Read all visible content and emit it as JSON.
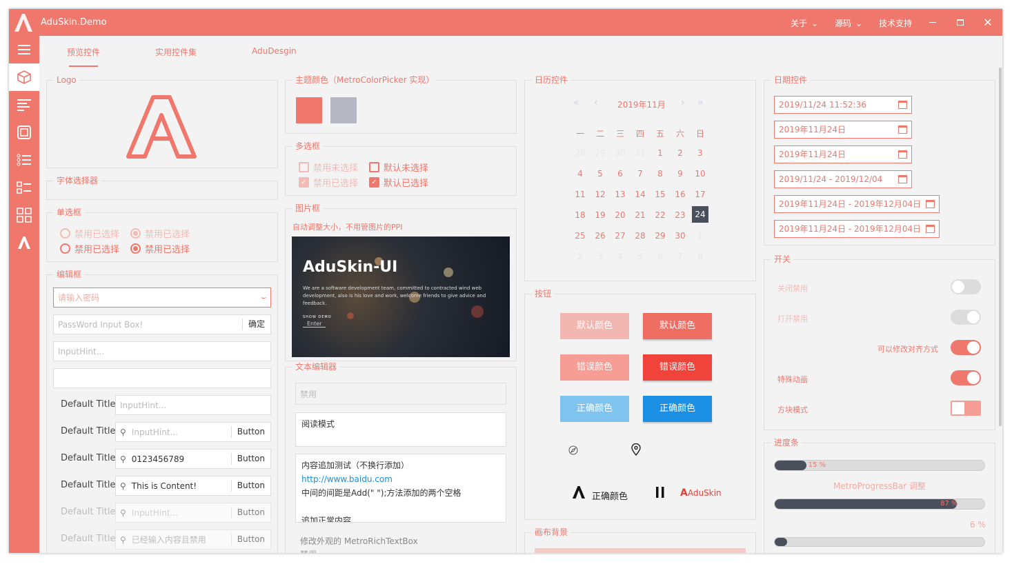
{
  "app": {
    "title": "AduSkin.Demo",
    "menu": [
      "关于",
      "源码",
      "技术支持"
    ]
  },
  "tabs": [
    "预览控件",
    "实用控件集",
    "AduDesgin"
  ],
  "logo": {
    "title": "Logo"
  },
  "font_picker": {
    "title": "字体选择器"
  },
  "radios": {
    "title": "单选框",
    "items": [
      {
        "label": "禁用已选择",
        "checked": false,
        "disabled": true
      },
      {
        "label": "禁用已选择",
        "checked": true,
        "disabled": true
      },
      {
        "label": "禁用已选择",
        "checked": false,
        "disabled": false
      },
      {
        "label": "禁用已选择",
        "checked": true,
        "disabled": false
      }
    ]
  },
  "editors": {
    "title": "编辑框",
    "password_placeholder": "请输入密码",
    "password_box_placeholder": "PassWord Input Box!",
    "confirm": "确定",
    "hint": "InputHint...",
    "rows": [
      {
        "label": "Default Title",
        "placeholder": "InputHint...",
        "value": "",
        "button": ""
      },
      {
        "label": "Default Title",
        "placeholder": "InputHint...",
        "value": "",
        "button": "Button"
      },
      {
        "label": "Default Title",
        "placeholder": "",
        "value": "0123456789",
        "button": "Button"
      },
      {
        "label": "Default Title",
        "placeholder": "",
        "value": "This is Content!",
        "button": "Button"
      },
      {
        "label": "Default Title",
        "placeholder": "InputHint...",
        "value": "",
        "button": "Button"
      },
      {
        "label": "Default Title",
        "placeholder": "已经输入内容且禁用",
        "value": "",
        "button": "Button"
      }
    ]
  },
  "theme": {
    "title": "主题颜色（MetroColorPicker 实现）",
    "colors": [
      "#f0776c",
      "#b5b8c3"
    ]
  },
  "checkboxes": {
    "title": "多选框",
    "items": [
      {
        "label": "禁用未选择",
        "checked": false,
        "disabled": true
      },
      {
        "label": "默认未选择",
        "checked": false,
        "disabled": false
      },
      {
        "label": "禁用已选择",
        "checked": true,
        "disabled": true
      },
      {
        "label": "默认已选择",
        "checked": true,
        "disabled": false
      }
    ]
  },
  "image": {
    "title": "图片框",
    "caption": "自动调整大小，不用管图片的PPI",
    "headline": "AduSkin-UI",
    "body": "We are a software development team, committed to contracted wind web development, also is his love and work, welcome friends to give advice and feedback.",
    "show": "SHOW DEMO",
    "enter": "Enter"
  },
  "text_editor": {
    "title": "文本编辑器",
    "disabled_ph": "禁用",
    "readonly": "阅读模式",
    "lines": [
      "内容追加测试（不换行添加）",
      "http://www.baidu.com",
      "中间的间距是Add(\"   \");方法添加的两个空格",
      "",
      "追加正常内容"
    ],
    "caption": "修改外观的 MetroRichTextBox",
    "caption2": "禁用"
  },
  "calendar": {
    "title": "日历控件",
    "month": "2019年11月",
    "weekdays": [
      "一",
      "二",
      "三",
      "四",
      "五",
      "六",
      "日"
    ],
    "weeks": [
      [
        "28",
        "29",
        "30",
        "31",
        "1",
        "2",
        "3"
      ],
      [
        "4",
        "5",
        "6",
        "7",
        "8",
        "9",
        "10"
      ],
      [
        "11",
        "12",
        "13",
        "14",
        "15",
        "16",
        "17"
      ],
      [
        "18",
        "19",
        "20",
        "21",
        "22",
        "23",
        "24"
      ],
      [
        "25",
        "26",
        "27",
        "28",
        "29",
        "30",
        "1"
      ],
      [
        "2",
        "3",
        "4",
        "5",
        "6",
        "7",
        "8"
      ]
    ],
    "today": "24"
  },
  "buttons": {
    "title": "按钮",
    "rows": [
      [
        "默认颜色",
        "默认颜色"
      ],
      [
        "错误颜色",
        "错误颜色"
      ],
      [
        "正确颜色",
        "正确颜色"
      ]
    ],
    "brand_text": "正确颜色",
    "adu": "AduSkin",
    "colors": {
      "default_dis": "#f3b7b1",
      "default": "#ef6e63",
      "error_dis": "#f69d95",
      "error": "#f0443a",
      "ok_dis": "#7ec4ef",
      "ok": "#1a8fe3"
    }
  },
  "canvas": {
    "title": "画布背景"
  },
  "dates": {
    "title": "日期控件",
    "values": [
      "2019/11/24 11:52:36",
      "2019年11月24日",
      "2019年11月24日",
      "2019/11/24 - 2019/12/04",
      "2019年11月24日 - 2019年12月04日",
      "2019年11月24日 - 2019年12月04日"
    ]
  },
  "switches": {
    "title": "开关",
    "items": [
      {
        "label": "关闭禁用",
        "on": false,
        "disabled": true
      },
      {
        "label": "打开禁用",
        "on": true,
        "disabled": true
      },
      {
        "label": "可以修改对齐方式",
        "on": true,
        "disabled": false
      },
      {
        "label": "特殊动画",
        "on": true,
        "disabled": false
      },
      {
        "label": "方块模式",
        "on": true,
        "disabled": false
      }
    ]
  },
  "progress": {
    "title": "进度条",
    "caption": "MetroProgressBar 调整",
    "bars": [
      {
        "value": 15,
        "label": "15 %"
      },
      {
        "value": 87,
        "label": "87 %"
      },
      {
        "value": 6,
        "label": "6 %"
      }
    ]
  }
}
